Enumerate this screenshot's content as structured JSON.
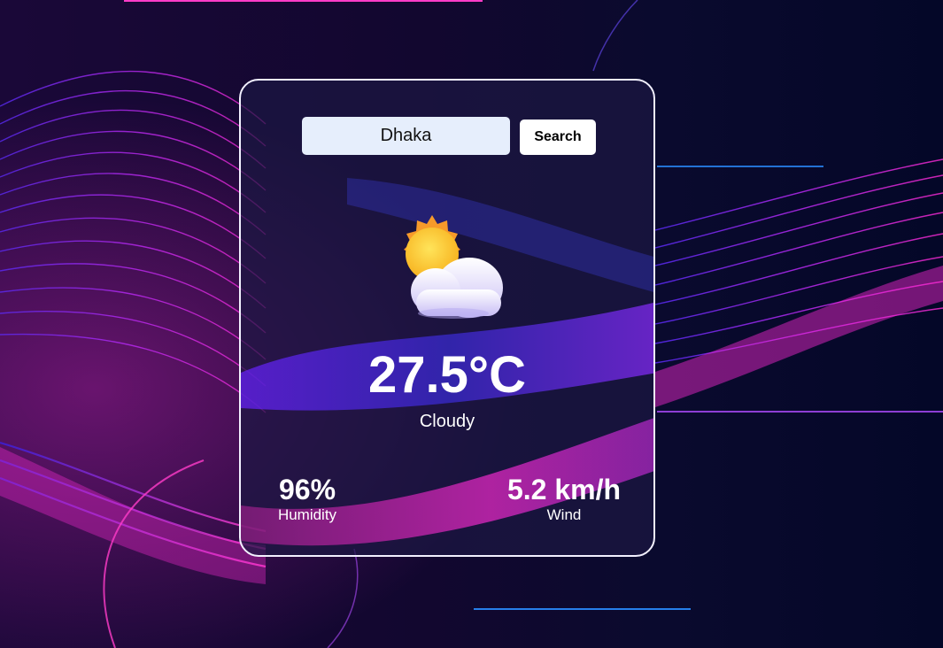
{
  "search": {
    "value": "Dhaka",
    "button_label": "Search"
  },
  "weather": {
    "icon": "sun-behind-cloud-icon",
    "temperature": "27.5°C",
    "condition": "Cloudy"
  },
  "stats": {
    "humidity": {
      "value": "96%",
      "label": "Humidity"
    },
    "wind": {
      "value": "5.2 km/h",
      "label": "Wind"
    }
  },
  "colors": {
    "accent_magenta": "#ff2bd6",
    "accent_purple": "#7a2cff",
    "card_border": "#f2f0ff",
    "input_background": "#e6eefc"
  }
}
